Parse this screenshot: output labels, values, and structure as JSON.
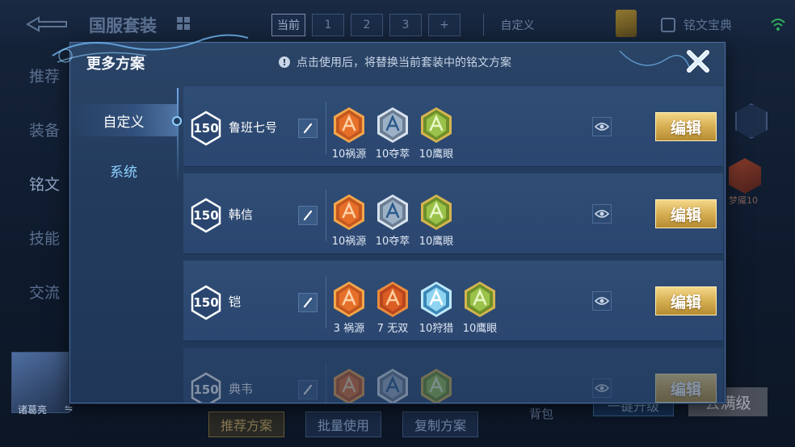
{
  "background": {
    "title": "国服套装",
    "tabs": [
      "当前",
      "1",
      "2",
      "3",
      "+"
    ],
    "custom_tab": "自定义",
    "rune_book": "铭文宝典",
    "left_nav": [
      "推荐",
      "装备",
      "铭文",
      "技能",
      "交流"
    ],
    "hero_name": "诸葛亮",
    "hero_swap": "⇋",
    "bottom_buttons": [
      "推荐方案",
      "批量使用",
      "复制方案"
    ],
    "bag": "背包",
    "right_button_1": "一键升级",
    "right_button_2": "去满级",
    "right_rune_label": "梦魇10"
  },
  "modal": {
    "title": "更多方案",
    "notice": "点击使用后，将替换当前套装中的铭文方案",
    "notice_icon": "!",
    "side_nav": [
      {
        "label": "自定义",
        "active": true
      },
      {
        "label": "系统",
        "active": false
      }
    ],
    "edit_label": "编辑",
    "plans": [
      {
        "level": "150",
        "name": "鲁班七号",
        "runes": [
          {
            "label": "10祸源",
            "color": "red"
          },
          {
            "label": "10夺萃",
            "color": "blue"
          },
          {
            "label": "10鹰眼",
            "color": "green"
          }
        ]
      },
      {
        "level": "150",
        "name": "韩信",
        "runes": [
          {
            "label": "10祸源",
            "color": "red"
          },
          {
            "label": "10夺萃",
            "color": "blue"
          },
          {
            "label": "10鹰眼",
            "color": "green"
          }
        ]
      },
      {
        "level": "150",
        "name": "铠",
        "runes": [
          {
            "label": "3 祸源",
            "color": "red"
          },
          {
            "label": "7 无双",
            "color": "red2"
          },
          {
            "label": "10狩猎",
            "color": "cyan"
          },
          {
            "label": "10鹰眼",
            "color": "green"
          }
        ]
      },
      {
        "level": "150",
        "name": "典韦",
        "runes": [
          {
            "label": "",
            "color": "red"
          },
          {
            "label": "",
            "color": "blue"
          },
          {
            "label": "",
            "color": "green"
          }
        ]
      }
    ]
  },
  "colors": {
    "modal_bg": "#2a4467",
    "edit_gold": "#d9b257",
    "side_active_text": "#ffffff",
    "side_inactive_text": "#8fd0ff"
  }
}
